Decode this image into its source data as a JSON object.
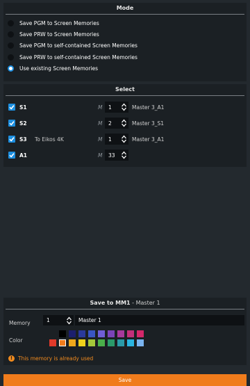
{
  "mode": {
    "title": "Mode",
    "options": [
      {
        "label": "Save PGM to Screen Memories",
        "selected": false
      },
      {
        "label": "Save PRW to Screen Memories",
        "selected": false
      },
      {
        "label": "Save PGM to self-contained Screen Memories",
        "selected": false
      },
      {
        "label": "Save PRW to self-contained Screen Memories",
        "selected": false
      },
      {
        "label": "Use existing Screen Memories",
        "selected": true
      }
    ]
  },
  "select": {
    "title": "Select",
    "m_label": "M",
    "rows": [
      {
        "name": "S1",
        "note": "",
        "checked": true,
        "memory": "1",
        "master": "Master 3_A1"
      },
      {
        "name": "S2",
        "note": "",
        "checked": true,
        "memory": "2",
        "master": "Master 3_S1"
      },
      {
        "name": "S3",
        "note": "To Eikos 4K",
        "checked": true,
        "memory": "1",
        "master": "Master 3_A1"
      },
      {
        "name": "A1",
        "note": "",
        "checked": true,
        "memory": "33",
        "master": ""
      }
    ]
  },
  "save_to": {
    "title": "Save to MM1",
    "title_separator": " - ",
    "subtitle": "Master 1",
    "memory_label": "Memory",
    "memory_number": "1",
    "memory_name": "Master 1",
    "color_label": "Color",
    "palette_top": [
      "#000000",
      "#1c1f6e",
      "#2a3a9c",
      "#3a56c4",
      "#6f5ed6",
      "#7a44b8",
      "#a63a9c",
      "#c2307a",
      "#d4286a"
    ],
    "palette_bottom": [
      "#e03a2a",
      "#f07c1c",
      "#f0a81c",
      "#f0d21c",
      "#a4c83a",
      "#4ab04a",
      "#2a9a6a",
      "#2a9aa8",
      "#2ab4e0",
      "#7ab4f0"
    ],
    "selected_color": "#f07c1c",
    "warning": "This memory is already used"
  },
  "save_button": "Save",
  "colors": {
    "accent_blue": "#1d8fe0",
    "accent_orange": "#f07c1c",
    "panel": "#1b2024",
    "background": "#23292e"
  }
}
